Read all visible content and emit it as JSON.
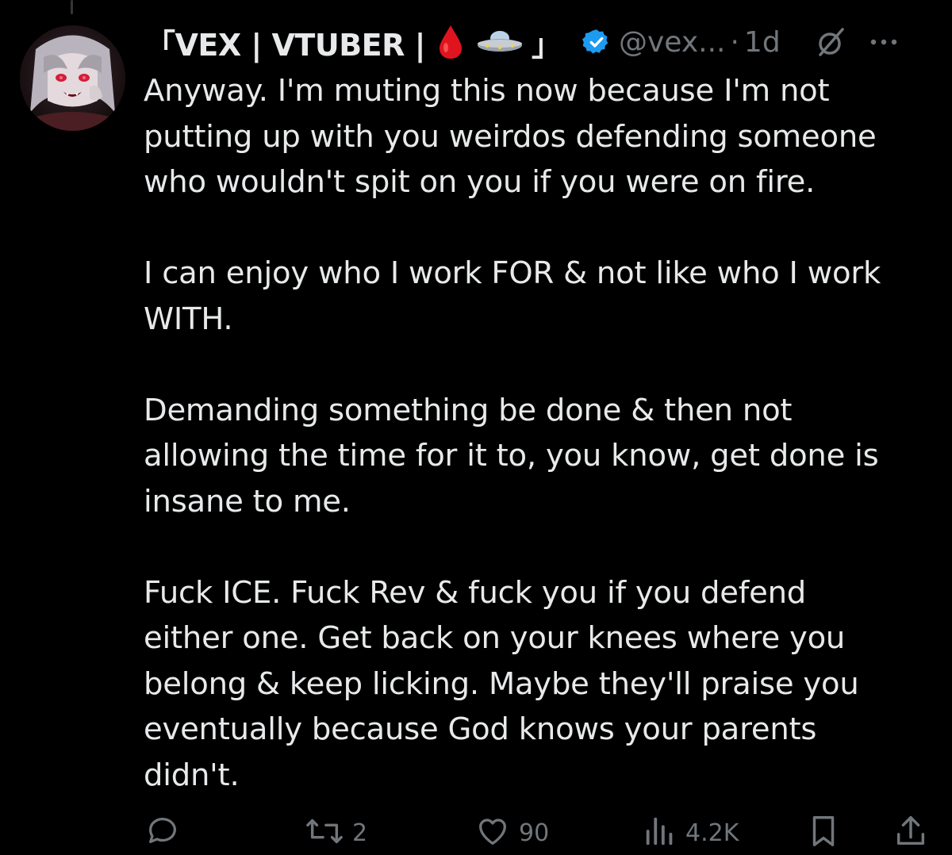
{
  "author": {
    "display_name": "「VEX | VTUBER |",
    "name_suffix": "」",
    "emoji": [
      "blood-drop-emoji",
      "flying-saucer-emoji"
    ],
    "handle": "@vex...",
    "separator": "·",
    "time": "1d",
    "verified": true
  },
  "post": {
    "paragraphs": [
      [
        "Anyway. I'm muting this now because I'm not",
        "putting up with you weirdos defending someone",
        "who wouldn't spit on you if you were on fire."
      ],
      [
        "I can enjoy who I work FOR & not like who I work",
        "WITH."
      ],
      [
        "Demanding something be done & then not",
        "allowing the time for it to, you know, get done is",
        "insane to me."
      ],
      [
        "Fuck ICE. Fuck Rev & fuck you if you defend",
        "either one. Get back on your knees where you",
        "belong & keep licking. Maybe they'll praise you",
        "eventually because God knows your parents",
        "didn't."
      ]
    ]
  },
  "actions": {
    "reply_count": "",
    "repost_count": "2",
    "like_count": "90",
    "views_count": "4.2K"
  },
  "colors": {
    "background": "#000000",
    "text": "#e7e9ea",
    "muted": "#71767b",
    "verified": "#1d9bf0"
  }
}
